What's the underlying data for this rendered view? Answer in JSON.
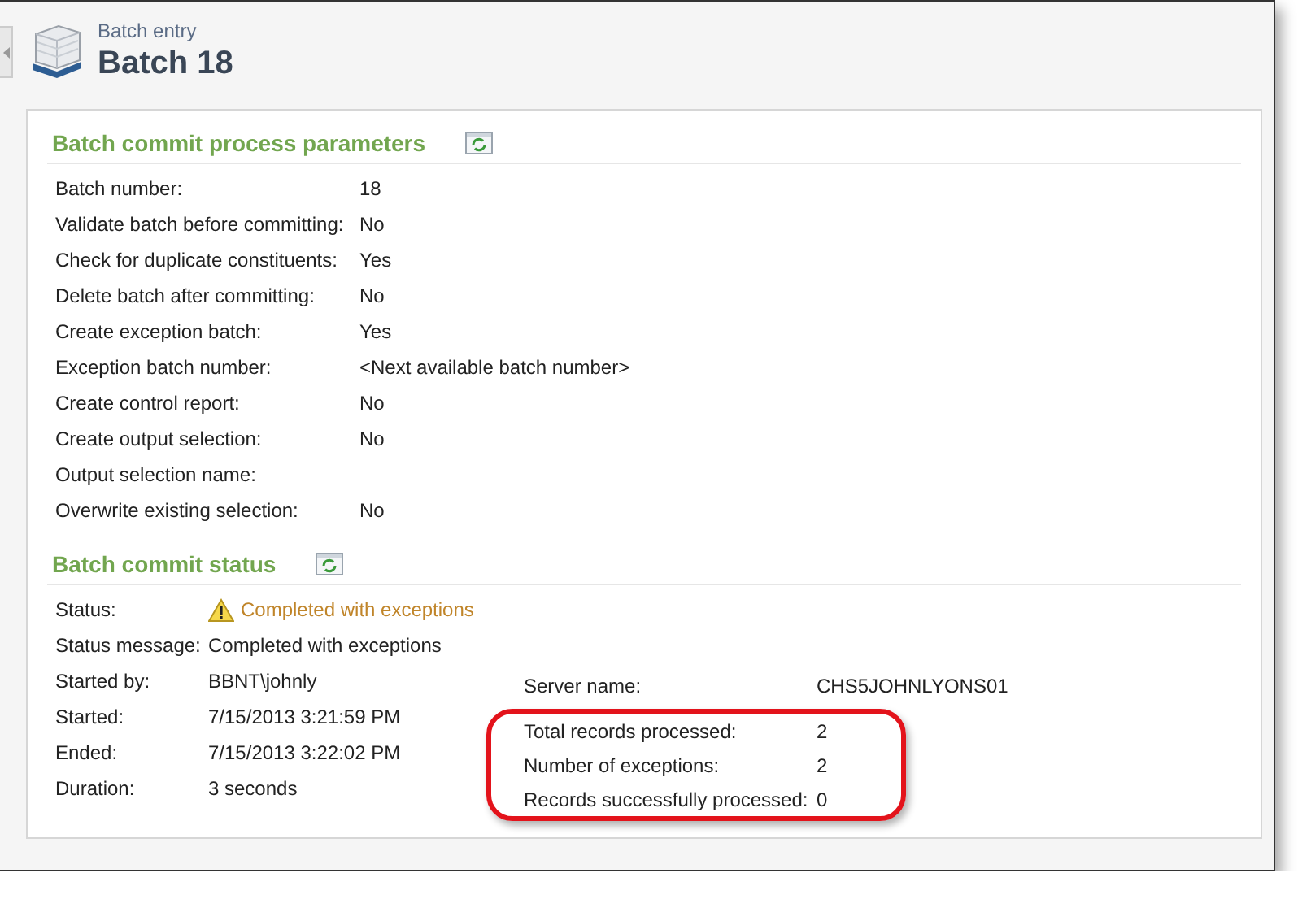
{
  "header": {
    "breadcrumb": "Batch entry",
    "title": "Batch 18"
  },
  "parameters": {
    "title": "Batch commit process parameters",
    "rows": [
      {
        "label": "Batch number:",
        "value": "18"
      },
      {
        "label": "Validate batch before committing:",
        "value": "No"
      },
      {
        "label": "Check for duplicate constituents:",
        "value": "Yes"
      },
      {
        "label": "Delete batch after committing:",
        "value": "No"
      },
      {
        "label": "Create exception batch:",
        "value": "Yes"
      },
      {
        "label": "Exception batch number:",
        "value": "<Next available batch number>"
      },
      {
        "label": "Create control report:",
        "value": "No"
      },
      {
        "label": "Create output selection:",
        "value": "No"
      },
      {
        "label": "Output selection name:"
      },
      {
        "label": "Overwrite existing selection:",
        "value": "No"
      }
    ]
  },
  "status": {
    "title": "Batch commit status",
    "full_rows": [
      {
        "label": "Status:",
        "value": "Completed with exceptions",
        "kind": "warning"
      },
      {
        "label": "Status message:",
        "value": "Completed with exceptions",
        "kind": "plain"
      }
    ],
    "left_rows": [
      {
        "label": "Started by:",
        "value": "BBNT\\johnly"
      },
      {
        "label": "Started:",
        "value": "7/15/2013 3:21:59 PM"
      },
      {
        "label": "Ended:",
        "value": "7/15/2013 3:22:02 PM"
      },
      {
        "label": "Duration:",
        "value": "3 seconds"
      }
    ],
    "right_rows": [
      {
        "label": "Server name:",
        "value": "CHS5JOHNLYONS01",
        "highlighted": false
      },
      {
        "label": "Total records processed:",
        "value": "2",
        "highlighted": true
      },
      {
        "label": "Number of exceptions:",
        "value": "2",
        "highlighted": true
      },
      {
        "label": "Records successfully processed:",
        "value": "0",
        "highlighted": true
      }
    ]
  }
}
